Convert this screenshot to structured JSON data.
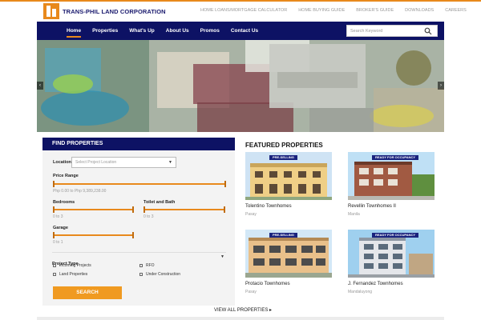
{
  "brand": {
    "name": "TRANS-PHIL",
    "suffix": "LAND CORPORATION"
  },
  "top_links": [
    "HOME LOANS/MORTGAGE CALCULATOR",
    "HOME BUYING GUIDE",
    "BROKER'S GUIDE",
    "DOWNLOADS",
    "CAREERS"
  ],
  "nav": {
    "items": [
      "Home",
      "Properties",
      "What's Up",
      "About Us",
      "Promos",
      "Contact Us"
    ],
    "active": "Home",
    "search_placeholder": "Search Keyword"
  },
  "hero": {
    "prev_label": "‹",
    "next_label": "›"
  },
  "find": {
    "title": "FIND PROPERTIES",
    "location_label": "Location",
    "location_placeholder": "Select Project Location",
    "price_label": "Price Range",
    "price_value": "Php 0.00 to Php 9,389,238.00",
    "bedrooms_label": "Bedrooms",
    "bedrooms_value": "0 to 3",
    "toilet_label": "Toilet and Bath",
    "toilet_value": "0 to 3",
    "garage_label": "Garage",
    "garage_value": "0 to 1",
    "project_type_label": "Project Type",
    "types": [
      "Incoming Projects",
      "RFO",
      "Land Properties",
      "Under Construction"
    ],
    "search_label": "SEARCH"
  },
  "featured": {
    "title": "FEATURED PROPERTIES",
    "cards": [
      {
        "name": "Tolentino Townhomes",
        "location": "Pasay",
        "badge": "PRE-SELLING"
      },
      {
        "name": "Revellin Townhomes II",
        "location": "Manila",
        "badge": "READY FOR OCCUPANCY"
      },
      {
        "name": "Protacio Townhomes",
        "location": "Pasay",
        "badge": "PRE-SELLING"
      },
      {
        "name": "J. Fernandez Townhomes",
        "location": "Mandaluyong",
        "badge": "READY FOR OCCUPANCY"
      }
    ],
    "view_all": "VIEW ALL PROPERTIES"
  },
  "colors": {
    "navy": "#0d1264",
    "orange": "#e8891c",
    "button": "#f09a21"
  }
}
